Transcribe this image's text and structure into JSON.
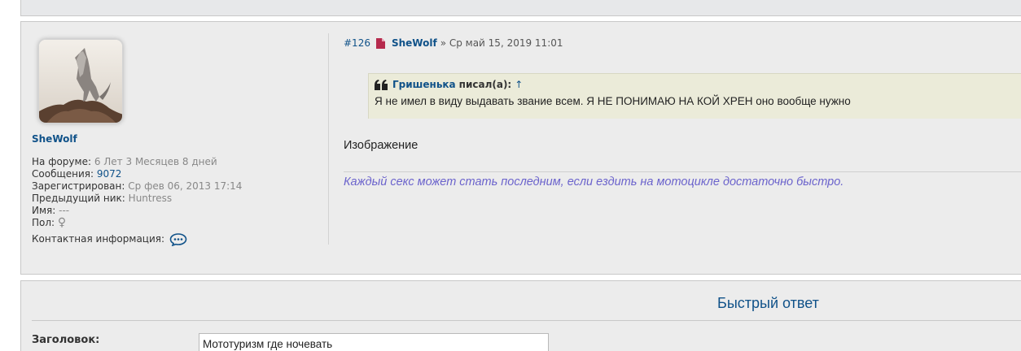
{
  "post": {
    "author": "SheWolf",
    "profile": {
      "forum_label": "На форуме:",
      "forum_value": "6 Лет 3 Месяцев 8 дней",
      "messages_label": "Сообщения:",
      "messages_value": "9072",
      "registered_label": "Зарегистрирован:",
      "registered_value": "Ср фев 06, 2013 17:14",
      "prev_nick_label": "Предыдущий ник:",
      "prev_nick_value": "Huntress",
      "name_label": "Имя:",
      "name_value": "---",
      "gender_label": "Пол:",
      "gender_value": "♀",
      "contact_label": "Контактная информация:"
    },
    "header": {
      "number": "#126",
      "author": "SheWolf",
      "datetime": "» Ср май 15, 2019 11:01"
    },
    "quote": {
      "author": "Гришенька",
      "wrote": "писал(а):",
      "up_arrow": "↑",
      "text": "Я не имел в виду выдавать звание всем. Я НЕ ПОНИМАЮ НА КОЙ ХРЕН оно вообще нужно"
    },
    "body": "Изображение",
    "signature": "Каждый секс может стать последним, если ездить на мотоцикле достаточно быстро."
  },
  "quick_reply": {
    "title": "Быстрый ответ",
    "subject_label": "Заголовок:",
    "subject_value": "Мототуризм где ночевать"
  },
  "icons": {
    "document": "document-icon",
    "quote": "quote-icon",
    "contact": "chat-bubble-icon",
    "gender": "female-icon"
  },
  "colors": {
    "link": "#105289",
    "signature": "#6b63cc",
    "quote_bg": "#ebebd9",
    "post_bg": "#ececec",
    "doc_icon": "#b62a4d"
  }
}
